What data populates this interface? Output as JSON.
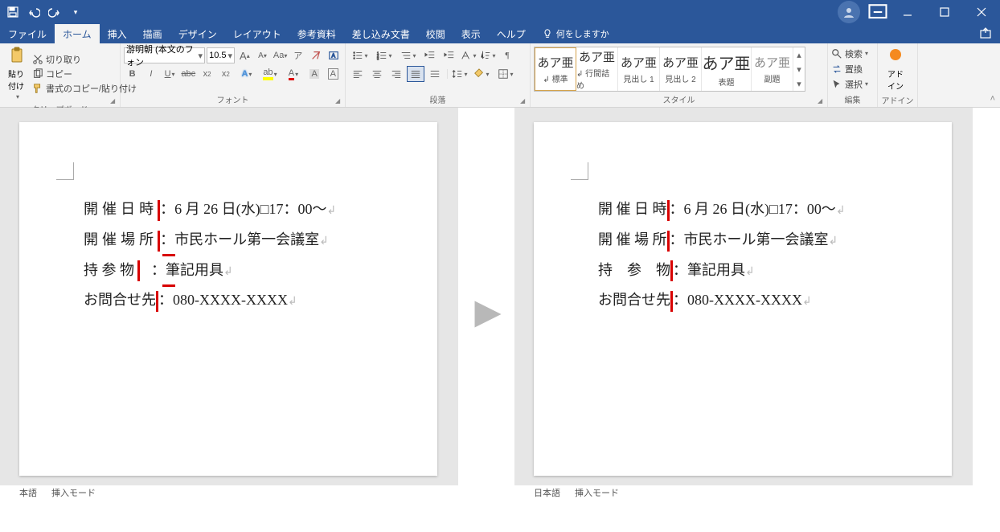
{
  "qat": {
    "save": "保存",
    "undo": "元に戻す",
    "redo": "やり直し"
  },
  "tabs": {
    "file": "ファイル",
    "home": "ホーム",
    "insert": "挿入",
    "draw": "描画",
    "design": "デザイン",
    "layout": "レイアウト",
    "references": "参考資料",
    "mailings": "差し込み文書",
    "review": "校閲",
    "view": "表示",
    "help": "ヘルプ",
    "tellme": "何をしますか"
  },
  "ribbon": {
    "clipboard": {
      "label": "クリップボード",
      "paste": "貼り付け",
      "cut": "切り取り",
      "copy": "コピー",
      "format_painter": "書式のコピー/貼り付け"
    },
    "font": {
      "label": "フォント",
      "name": "游明朝 (本文のフォン",
      "size": "10.5"
    },
    "paragraph": {
      "label": "段落"
    },
    "styles": {
      "label": "スタイル",
      "items": [
        {
          "preview": "あア亜",
          "name": "↲ 標準"
        },
        {
          "preview": "あア亜",
          "name": "↲ 行間詰め"
        },
        {
          "preview": "あア亜",
          "name": "見出し 1"
        },
        {
          "preview": "あア亜",
          "name": "見出し 2"
        },
        {
          "preview": "あア亜",
          "name": "表題"
        },
        {
          "preview": "あア亜",
          "name": "副題"
        }
      ]
    },
    "editing": {
      "label": "編集",
      "find": "検索",
      "replace": "置換",
      "select": "選択"
    },
    "addins": {
      "label": "アドイン",
      "btn": "アド\nイン"
    }
  },
  "doc_left": {
    "lines": [
      {
        "label": "開催日時",
        "sep": "：",
        "value": "6 月 26 日(水)□17：00～",
        "spacing": "lbl"
      },
      {
        "label": "開催場所",
        "sep": "：",
        "value": "市民ホール第一会議室",
        "spacing": "lbl"
      },
      {
        "label": "持 参 物",
        "sep": "：",
        "value": "筆記用具",
        "spacing": "sp3"
      },
      {
        "label": "お問合せ先",
        "sep": "：",
        "value": "080-XXXX-XXXX",
        "spacing": ""
      }
    ]
  },
  "doc_right": {
    "lines": [
      {
        "label": "開 催 日 時",
        "sep": "：",
        "value": "6 月 26 日(水)□17：00～"
      },
      {
        "label": "開 催 場 所",
        "sep": "：",
        "value": "市民ホール第一会議室"
      },
      {
        "label": "持　参　物",
        "sep": "：",
        "value": "筆記用具"
      },
      {
        "label": "お問合せ先",
        "sep": "：",
        "value": "080-XXXX-XXXX"
      }
    ]
  },
  "status": {
    "lang_left": "本語",
    "mode": "挿入モード",
    "lang_right": "日本語"
  }
}
